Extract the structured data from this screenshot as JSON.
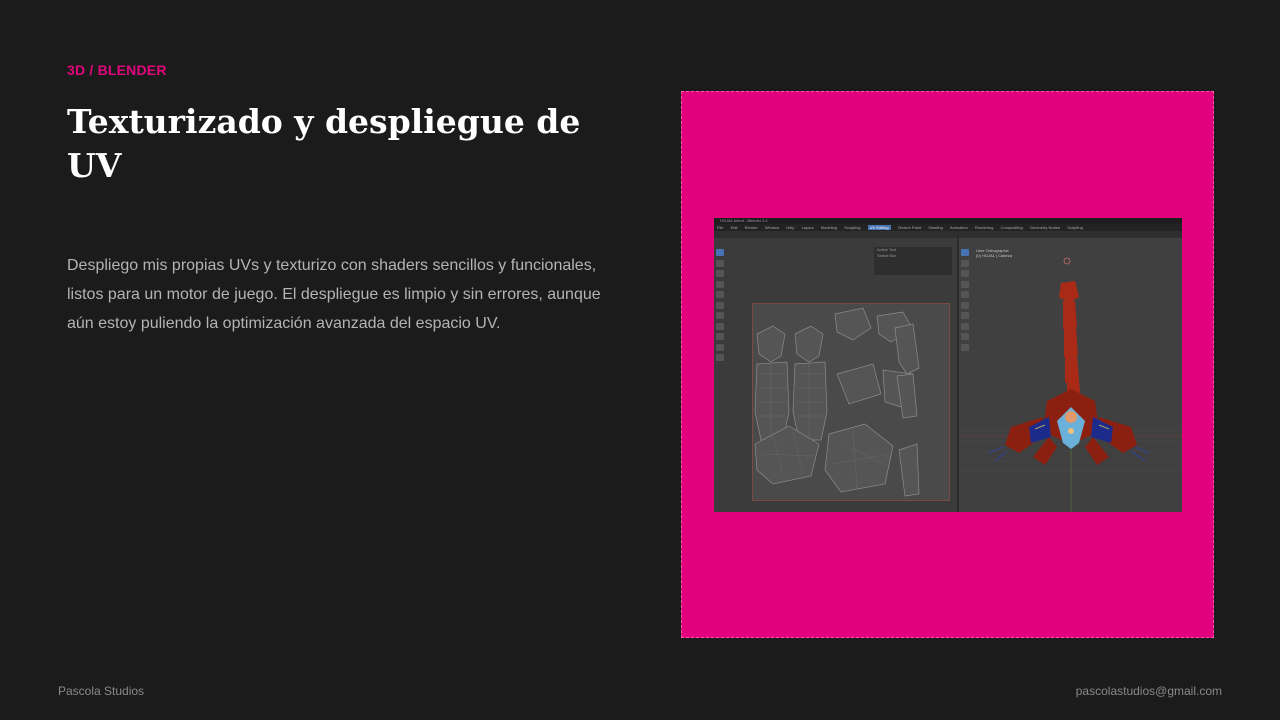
{
  "slide": {
    "eyebrow": "3D / BLENDER",
    "title": "Texturizado y despliegue de UV",
    "body": "Despliego mis propias UVs y texturizo con shaders sencillos y funcionales, listos para un motor de juego. El despliegue es limpio y sin errores, aunque aún estoy puliendo la optimización avanzada del espacio UV."
  },
  "screenshot": {
    "window_title": "HOJA1.blend - Blender 3.1",
    "menu": [
      "File",
      "Edit",
      "Render",
      "Window",
      "Help",
      "Layout",
      "Modeling",
      "Sculpting",
      "UV Editing",
      "Texture Paint",
      "Shading",
      "Animation",
      "Rendering",
      "Compositing",
      "Geometry Nodes",
      "Scripting"
    ],
    "active_workspace": "UV Editing",
    "uv_panel": [
      "Active Tool",
      "Select Box"
    ],
    "viewport_info": [
      "User Orthographic",
      "(0) HOJA1 | Cabeza"
    ]
  },
  "colors": {
    "accent": "#e3007c",
    "background": "#1b1b1b"
  },
  "footer": {
    "left": "Pascola Studios",
    "right": "pascolastudios@gmail.com"
  }
}
